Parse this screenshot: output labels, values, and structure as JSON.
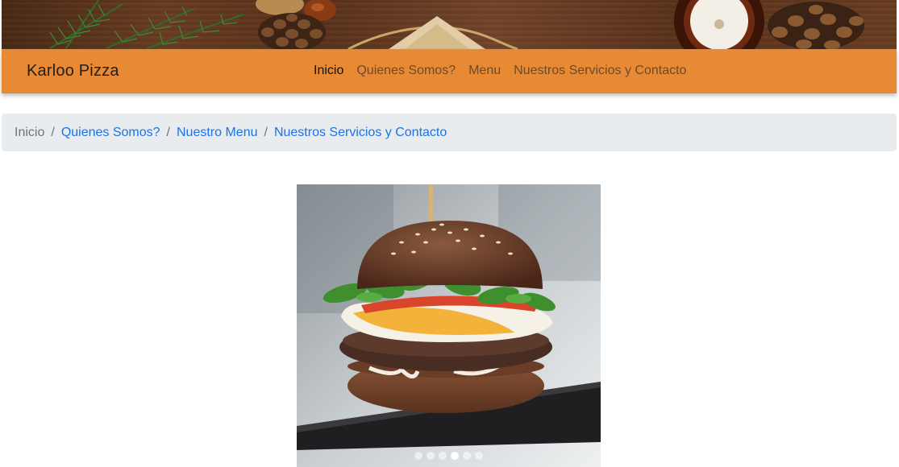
{
  "navbar": {
    "brand": "Karloo Pizza",
    "links": [
      {
        "label": "Inicio",
        "active": true
      },
      {
        "label": "Quienes Somos?",
        "active": false
      },
      {
        "label": "Menu",
        "active": false
      },
      {
        "label": "Nuestros Servicios y Contacto",
        "active": false
      }
    ],
    "background": "#e88a33"
  },
  "breadcrumb": {
    "current": "Inicio",
    "separator": "/",
    "links": [
      "Quienes Somos?",
      "Nuestro Menu",
      "Nuestros Servicios y Contacto"
    ],
    "link_color": "#1a73e8"
  },
  "carousel": {
    "slide_count": 6,
    "active_index": 3,
    "image": "burger-photo"
  },
  "banner": {
    "image": "wooden-table-with-pine-cones-and-candle"
  }
}
